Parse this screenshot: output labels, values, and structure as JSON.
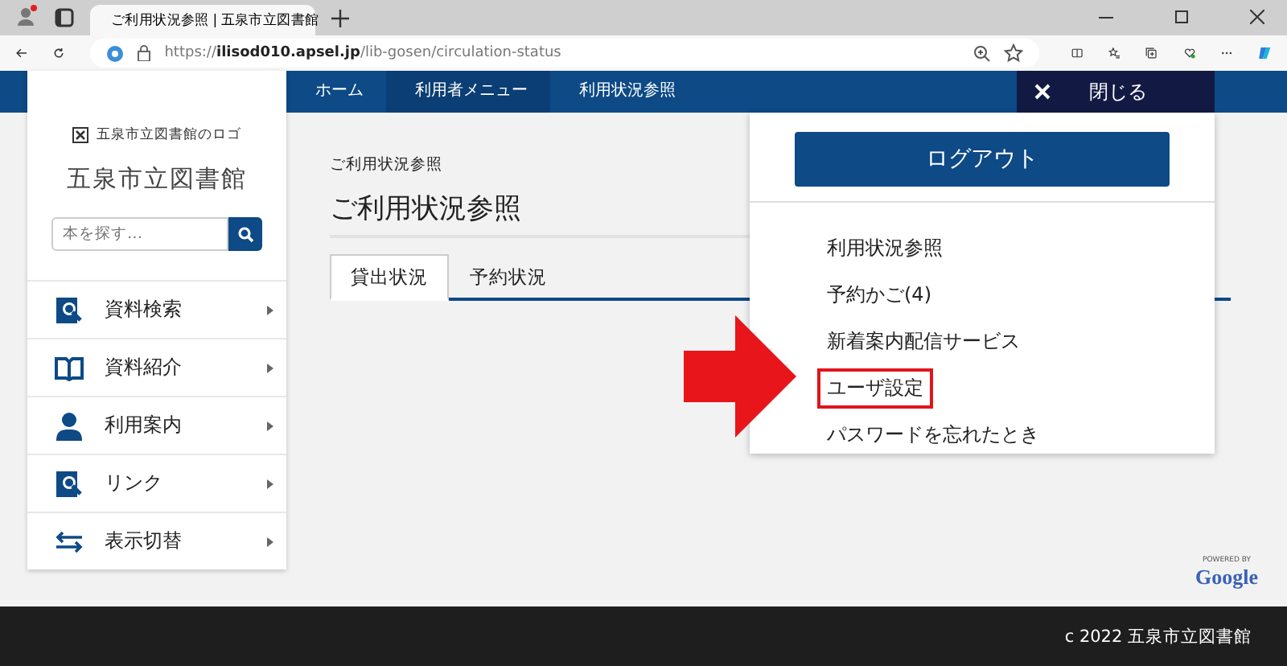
{
  "browser": {
    "tab_title": "ご利用状況参照 | 五泉市立図書館",
    "url": "https://**ilisod010.apsel.jp**/lib-gosen/circulation-status"
  },
  "breadcrumbs": [
    {
      "label": "ホーム"
    },
    {
      "label": "利用者メニュー"
    },
    {
      "label": "利用状況参照"
    }
  ],
  "sidebar": {
    "logo_alt": "五泉市立図書館のロゴ",
    "title": "五泉市立図書館",
    "search": {
      "placeholder": "本を探す…"
    },
    "items": [
      {
        "label": "資料検索",
        "kind": "search"
      },
      {
        "label": "資料紹介",
        "kind": "book"
      },
      {
        "label": "利用案内",
        "kind": "person"
      },
      {
        "label": "リンク",
        "kind": "search"
      },
      {
        "label": "表示切替",
        "kind": "swap"
      }
    ]
  },
  "page": {
    "breadcrumb_title": "ご利用状況参照",
    "heading": "ご利用状況参照",
    "tabs": [
      {
        "label": "貸出状況",
        "selected": true
      },
      {
        "label": "予約状況",
        "selected": false
      }
    ]
  },
  "user_menu": {
    "close_label": "閉じる",
    "logout": "ログアウト",
    "links": [
      {
        "label": "利用状況参照",
        "highlighted": false
      },
      {
        "label": "予約かご(4)",
        "highlighted": false
      },
      {
        "label": "新着案内配信サービス",
        "highlighted": false
      },
      {
        "label": "ユーザ設定",
        "highlighted": true
      },
      {
        "label": "パスワードを忘れたとき",
        "highlighted": false
      }
    ]
  },
  "powered_by": {
    "caption": "POWERED BY",
    "brand": "Google"
  },
  "footer": "c 2022 五泉市立図書館"
}
